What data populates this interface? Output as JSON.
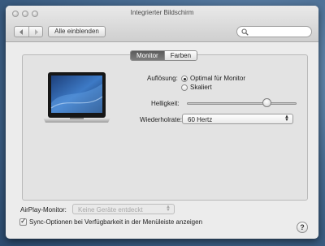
{
  "window": {
    "title": "Integrierter Bildschirm",
    "controls": [
      "close",
      "minimize",
      "zoom"
    ]
  },
  "toolbar": {
    "back_icon": "chevron-left-icon",
    "forward_icon": "chevron-right-icon",
    "show_all_label": "Alle einblenden",
    "search": {
      "value": "",
      "placeholder": "",
      "icon": "magnifier-icon"
    }
  },
  "tabs": [
    {
      "label": "Monitor",
      "selected": true
    },
    {
      "label": "Farben",
      "selected": false
    }
  ],
  "display": {
    "image": "macbook-laptop-with-blue-wallpaper",
    "resolution": {
      "label": "Auflösung:",
      "options": [
        {
          "label": "Optimal für Monitor",
          "selected": true
        },
        {
          "label": "Skaliert",
          "selected": false
        }
      ]
    },
    "brightness": {
      "label": "Helligkeit:",
      "level": 0.73
    },
    "refresh_rate": {
      "label": "Wiederholrate:",
      "value": "60 Hertz"
    }
  },
  "airplay": {
    "label": "AirPlay-Monitor:",
    "value": "Keine Geräte entdeckt",
    "enabled": false
  },
  "sync_option": {
    "label": "Sync-Optionen bei Verfügbarkeit in der Menüleiste anzeigen",
    "checked": true
  },
  "help": {
    "label": "?"
  }
}
